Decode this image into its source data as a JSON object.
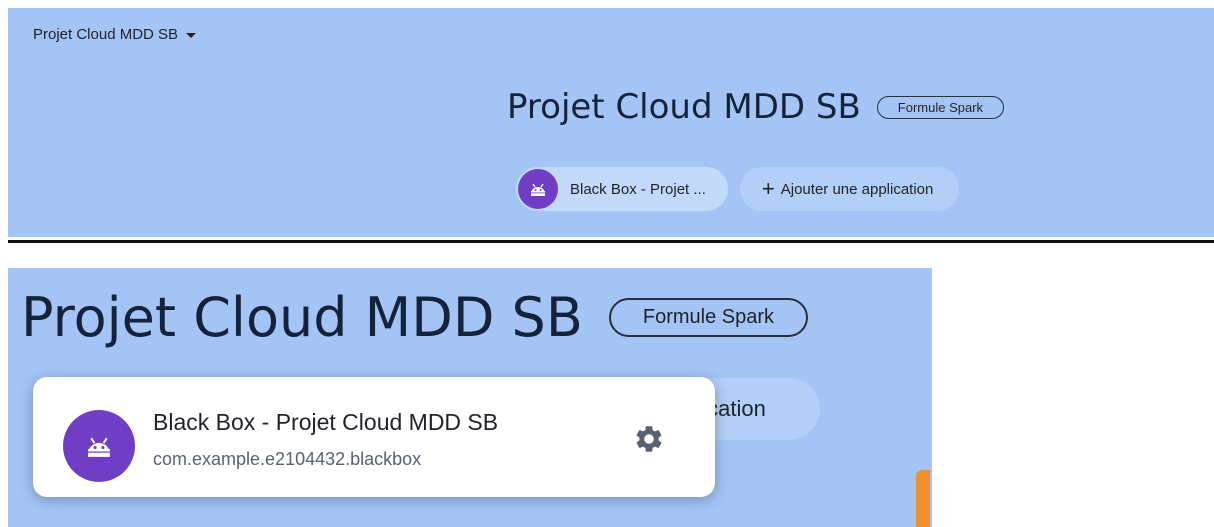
{
  "header": {
    "project_selector": "Projet Cloud MDD SB",
    "project_title": "Projet Cloud MDD SB",
    "plan_badge": "Formule Spark"
  },
  "apps": {
    "chip_label": "Black Box - Projet ...",
    "add_label": "Ajouter une application",
    "add_label_partial": "Ajouter une application"
  },
  "popover": {
    "app_name": "Black Box - Projet Cloud MDD SB",
    "package_id": "com.example.e2104432.blackbox"
  },
  "icons": {
    "caret": "caret-down-icon",
    "android": "android-icon",
    "plus": "plus-icon",
    "gear": "gear-icon"
  },
  "colors": {
    "banner": "#a4c4f6",
    "android_badge": "#6f3ec4",
    "card": "#ffffff"
  }
}
